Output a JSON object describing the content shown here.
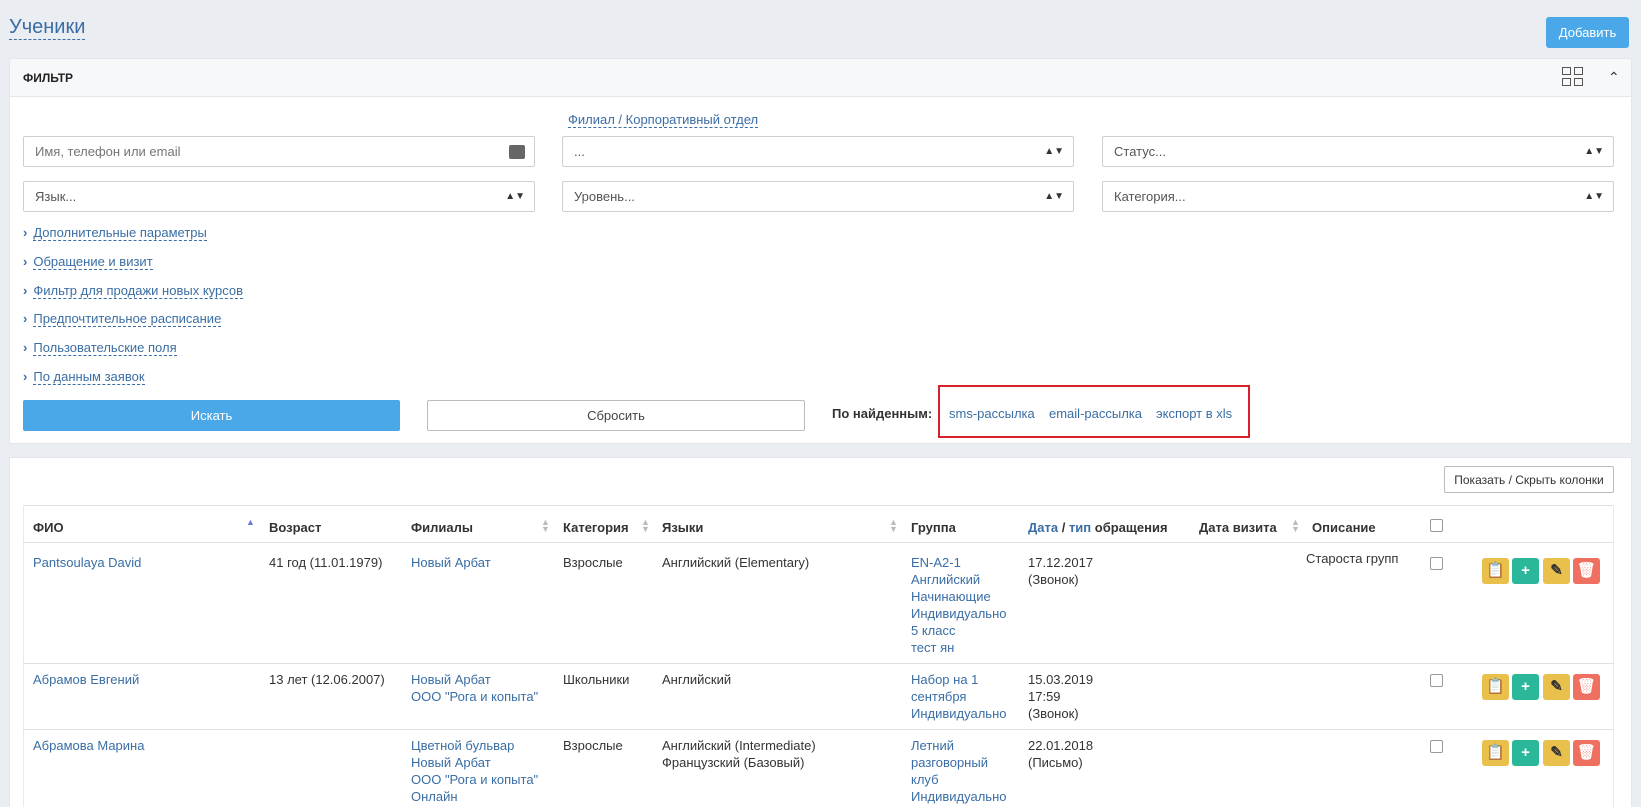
{
  "page": {
    "title": "Ученики",
    "add_label": "Добавить"
  },
  "filter": {
    "title": "ФИЛЬТР",
    "branch_link": "Филиал / Корпоративный отдел",
    "search_placeholder": "Имя, телефон или email",
    "branch_select": "...",
    "status_select": "Статус...",
    "language_select": "Язык...",
    "level_select": "Уровень...",
    "category_select": "Категория...",
    "expanders": [
      "Дополнительные параметры",
      "Обращение и визит",
      "Фильтр для продажи новых курсов",
      "Предпочтительное расписание",
      "Пользовательские поля",
      "По данным заявок"
    ],
    "search_label": "Искать",
    "reset_label": "Сбросить",
    "found_label": "По найденным:",
    "found_links": [
      "sms-рассылка",
      "email-рассылка",
      "экспорт в xls"
    ]
  },
  "table": {
    "columns_button": "Показать / Скрыть колонки",
    "headers": {
      "fio": "ФИО",
      "age": "Возраст",
      "branches": "Филиалы",
      "category": "Категория",
      "languages": "Языки",
      "group": "Группа",
      "contact_date": "Дата",
      "contact_sep": " / ",
      "contact_type": "тип",
      "contact_rest": " обращения",
      "visit_date": "Дата визита",
      "description": "Описание"
    },
    "rows": [
      {
        "name": "Pantsoulaya David",
        "age": "41 год (11.01.1979)",
        "branches": "Новый Арбат",
        "category": "Взрослые",
        "languages": "Английский (Elementary)",
        "group": "EN-A2-1\nАнглийский\nНачинающие\nИндивидуально\n5 класс\nтест ян",
        "contact": "17.12.2017\n(Звонок)",
        "description": "Староста групп"
      },
      {
        "name": "Абрамов Евгений",
        "age": "13 лет (12.06.2007)",
        "branches": "Новый Арбат\nООО \"Рога и копыта\"",
        "category": "Школьники",
        "languages": "Английский",
        "group": "Набор на 1\nсентября\nИндивидуально",
        "contact": "15.03.2019\n17:59\n(Звонок)",
        "description": ""
      },
      {
        "name": "Абрамова Марина",
        "age": "",
        "branches": "Цветной бульвар\nНовый Арбат\nООО \"Рога и копыта\"\nОнлайн",
        "category": "Взрослые",
        "languages": "Английский (Intermediate)\nФранцузский (Базовый)",
        "group": "Летний\nразговорный\nклуб\nИндивидуально",
        "contact": "22.01.2018\n(Письмо)",
        "description": ""
      }
    ]
  },
  "icons": {
    "grid": "grid-icon",
    "collapse": "chevron-up-icon",
    "keyboard": "keyboard-icon",
    "sort": "sort-icon",
    "clipboard": "clipboard-icon",
    "plus": "plus-icon",
    "edit": "pencil-icon",
    "delete": "trash-icon"
  },
  "colors": {
    "primary": "#4aa8e8",
    "link": "#3a6ea5",
    "highlight": "#d9202a",
    "action_yellow": "#e9c04c",
    "action_green": "#2bb79a",
    "action_red": "#ef6f60"
  }
}
